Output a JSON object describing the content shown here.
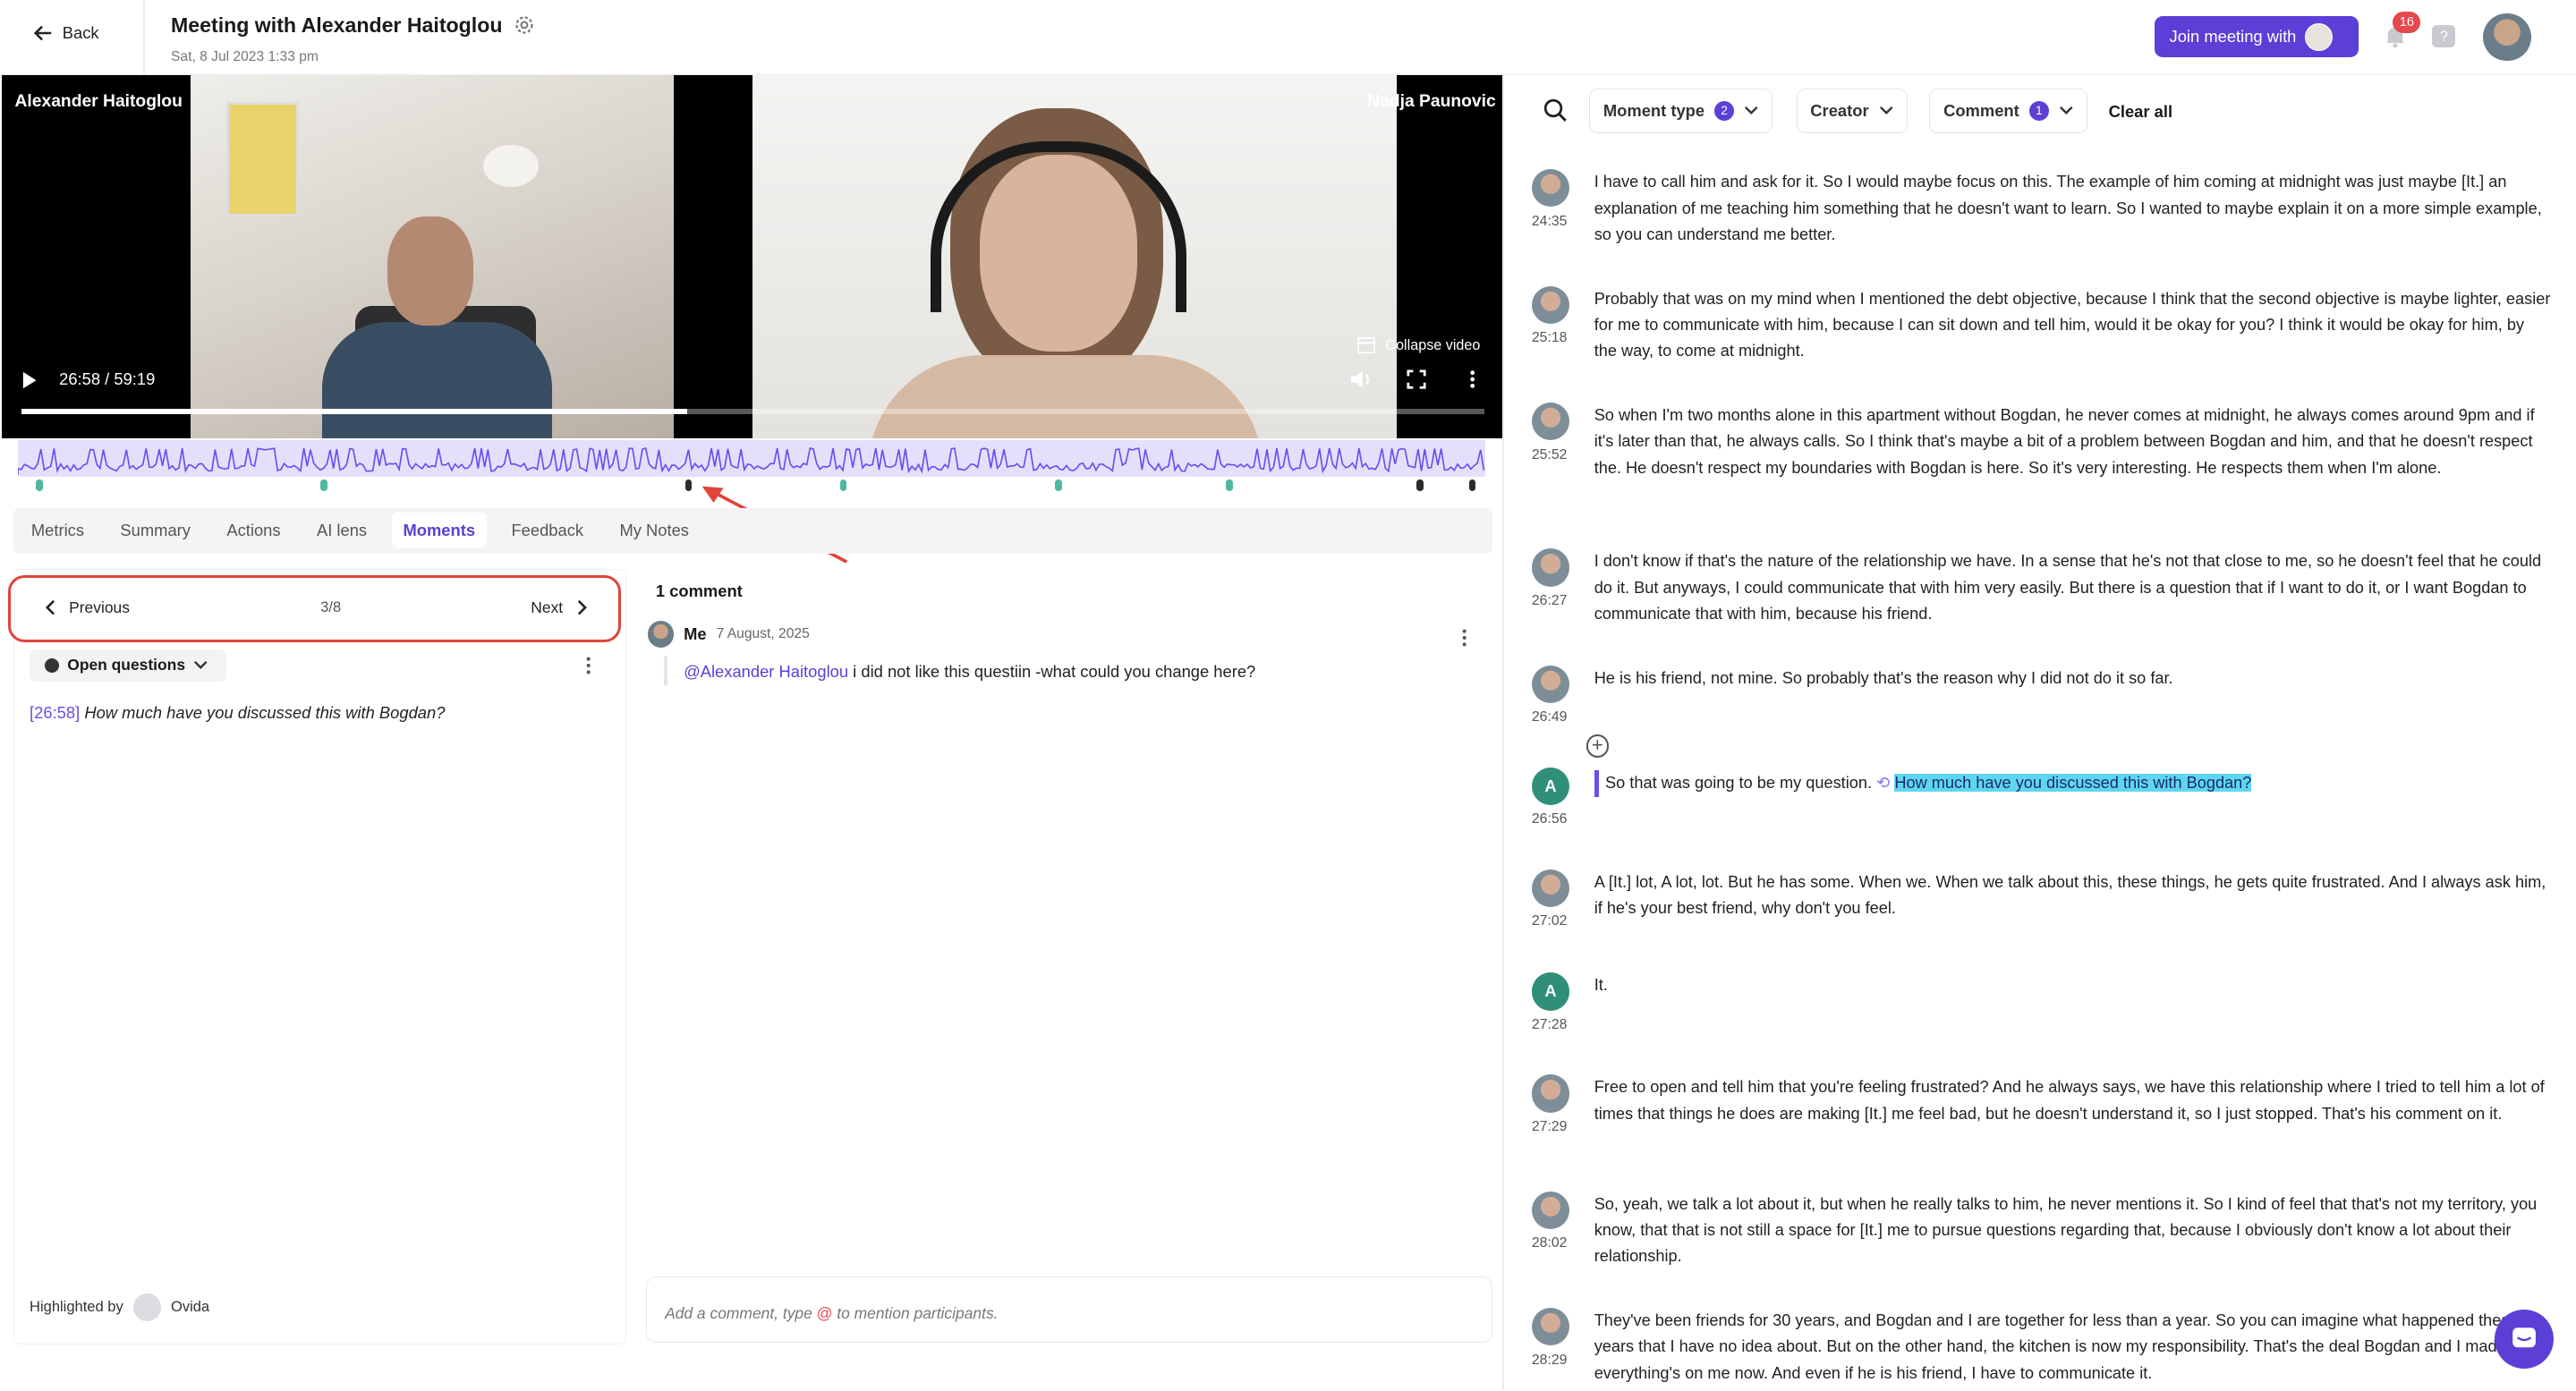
{
  "header": {
    "back_label": "Back",
    "title": "Meeting with Alexander Haitoglou",
    "date": "Sat, 8 Jul 2023 1:33 pm",
    "join_label": "Join meeting with",
    "notifications": "16",
    "help": "?"
  },
  "video": {
    "left_name": "Alexander Haitoglou",
    "right_name": "Nadja Paunovic",
    "time": "26:58 / 59:19",
    "collapse_label": "Collapse video",
    "progress": 0.455
  },
  "tabs": [
    "Metrics",
    "Summary",
    "Actions",
    "AI lens",
    "Moments",
    "Feedback",
    "My Notes"
  ],
  "moments": {
    "prev": "Previous",
    "counter": "3/8",
    "next": "Next",
    "tag": "Open questions",
    "timestamp": "[26:58]",
    "question": "How much have you discussed this with Bogdan?",
    "highlighted_by": "Highlighted by",
    "highlighter": "Ovida"
  },
  "comments": {
    "count_label": "1 comment",
    "author": "Me",
    "date": "7 August, 2025",
    "mention": "@Alexander Haitoglou",
    "text": " i did not like this questiin -what could you change here?",
    "placeholder_a": "Add a comment, type ",
    "placeholder_at": "@",
    "placeholder_b": " to mention participants."
  },
  "filters": {
    "moment_type": "Moment type",
    "moment_count": "2",
    "creator": "Creator",
    "comment": "Comment",
    "comment_count": "1",
    "clear": "Clear all"
  },
  "transcript": [
    {
      "av": "photo",
      "time": "24:35",
      "text": "I have to call him and ask for it. So I would maybe focus on this. The example of him coming at midnight was just maybe [It.] an explanation of me teaching him something that he doesn't want to learn. So I wanted to maybe explain it on a more simple example, so you can understand me better."
    },
    {
      "av": "photo",
      "time": "25:18",
      "text": "Probably that was on my mind when I mentioned the debt objective, because I think that the second objective is maybe lighter, easier for me to communicate with him, because I can sit down and tell him, would it be okay for you? I think it would be okay for him, by the way, to come at midnight."
    },
    {
      "av": "photo",
      "time": "25:52",
      "text": "So when I'm two months alone in this apartment without Bogdan, he never comes at midnight, he always comes around 9pm and if it's later than that, he always calls. So I think that's maybe a bit of a problem between Bogdan and him, and that he doesn't respect the. He doesn't respect my boundaries with Bogdan is here. So it's very interesting. He respects them when I'm alone."
    },
    {
      "av": "photo",
      "time": "26:27",
      "text": "I don't know if that's the nature of the relationship we have. In a sense that he's not that close to me, so he doesn't feel that he could do it. But anyways, I could communicate that with him very easily. But there is a question that if I want to do it, or I want Bogdan to communicate that with him, because his friend."
    },
    {
      "av": "photo",
      "time": "26:49",
      "text": "He is his friend, not mine. So probably that's the reason why I did not do it so far."
    },
    {
      "av": "A",
      "time": "26:56",
      "text": "So that was going to be my question. ",
      "highlight": "How much have you discussed this with Bogdan?"
    },
    {
      "av": "photo",
      "time": "27:02",
      "text": "A [It.] lot, A lot, lot. But he has some. When we. When we talk about this, these things, he gets quite frustrated. And I always ask him, if he's your best friend, why don't you feel."
    },
    {
      "av": "A",
      "time": "27:28",
      "text": "It."
    },
    {
      "av": "photo",
      "time": "27:29",
      "text": "Free to open and tell him that you're feeling frustrated? And he always says, we have this relationship where I tried to tell him a lot of times that things he does are making [It.] me feel bad, but he doesn't understand it, so I just stopped. That's his comment on it."
    },
    {
      "av": "photo",
      "time": "28:02",
      "text": "So, yeah, we talk a lot about it, but when he really talks to him, he never mentions it. So I kind of feel that that's not my territory, you know, that that is not still a space for [It.] me to pursue questions regarding that, because I obviously don't know a lot about their relationship."
    },
    {
      "av": "photo",
      "time": "28:29",
      "text": "They've been friends for 30 years, and Bogdan and I are together for less than a year. So you can imagine what happened these 30 years that I have no idea about. But on the other hand, the kitchen is now my responsibility. That's the deal Bogdan and I made. So everything's on me now. And even if he is his friend, I have to communicate it."
    }
  ]
}
